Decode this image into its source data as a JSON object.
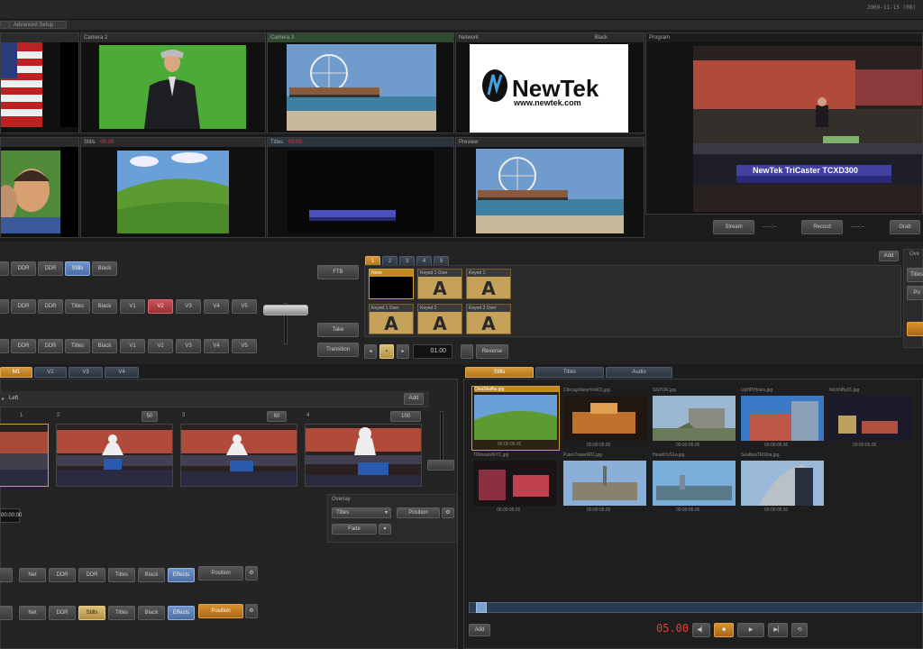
{
  "app": {
    "clock": "2009-11-15 (08)"
  },
  "top_tabs": [
    "",
    "Advanced Setup"
  ],
  "monitors": {
    "camera1": {
      "label": ""
    },
    "camera2": {
      "label": "Camera 2"
    },
    "camera3": {
      "label": "Camera 3"
    },
    "network": {
      "label": "Network",
      "extra": "Black"
    },
    "program": {
      "label": "Program"
    },
    "cam5": {
      "label": ""
    },
    "stills": {
      "label": "Stills",
      "time": "05:00"
    },
    "titles": {
      "label": "Titles",
      "time": "05:00"
    },
    "preview": {
      "label": "Preview"
    }
  },
  "newtek": {
    "brand": "NewTek",
    "url": "www.newtek.com"
  },
  "program_lower_third": "NewTek TriCaster TCXD300",
  "program_controls": {
    "stream": "Stream",
    "record": "Record",
    "grab": "Grab",
    "stream_time": "--:--:--",
    "record_time": "--:--:--"
  },
  "switcher": {
    "row1": [
      "",
      "DDR",
      "DDR",
      "Stills",
      "Black"
    ],
    "row2": [
      "",
      "DDR",
      "DDR",
      "Titles",
      "Black",
      "V1",
      "V2",
      "V3",
      "V4",
      "V5"
    ],
    "row3": [
      "",
      "DDR",
      "DDR",
      "Titles",
      "Black",
      "V1",
      "V2",
      "V3",
      "V4",
      "V5"
    ],
    "ftb": "FTB",
    "take": "Take",
    "transition": "Transition"
  },
  "trans": {
    "tabs": [
      "1",
      "2",
      "3",
      "4",
      "5"
    ],
    "add": "Add",
    "rate": "01.00",
    "reverse": "Reverse",
    "presets": [
      {
        "name": "None"
      },
      {
        "name": "Keyed 1 Over"
      },
      {
        "name": "Keyed 1"
      },
      {
        "name": "Keyed 1 Over"
      },
      {
        "name": "Keyed 2"
      },
      {
        "name": "Keyed 2 Over"
      }
    ]
  },
  "right_edge": {
    "label": "Ove",
    "b1": "Titles",
    "b2": "Po"
  },
  "vset_tabs": [
    "M1",
    "V2",
    "V3",
    "V4"
  ],
  "vset": {
    "title": "Left",
    "add": "Add",
    "positions": [
      "1",
      "2",
      "3",
      "4"
    ],
    "pos_values": [
      "",
      "50",
      "60",
      "100"
    ],
    "time": "00:00:00"
  },
  "overlay": {
    "label": "Overlay",
    "source": "Titles",
    "position": "Position",
    "fade": "Fade"
  },
  "bottom_rows": {
    "row1": [
      "",
      "Net",
      "DDR",
      "DDR",
      "Titles",
      "Black",
      "Effects"
    ],
    "row2": [
      "",
      "Net",
      "DDR",
      "Stills",
      "Titles",
      "Black",
      "Effects"
    ],
    "position": "Position",
    "orange": "Position"
  },
  "media_tabs": [
    "Stills",
    "Titles",
    "Audio"
  ],
  "media_items": [
    {
      "name": "CleaSkaflip.jpg",
      "time": "00:00:05.00"
    },
    {
      "name": "ChicagoNewYork01.jpg",
      "time": "00:00:05.00"
    },
    {
      "name": "SNYOR.jpg",
      "time": "00:00:05.00"
    },
    {
      "name": "UpHPlHoles.jpg",
      "time": "00:00:05.00"
    },
    {
      "name": "NIchNBy01.jpg",
      "time": "00:00:05.00"
    },
    {
      "name": "TIMonatsNYC.jpg",
      "time": "00:00:05.00"
    },
    {
      "name": "PulesTowerR01.jpg",
      "time": "00:00:05.00"
    },
    {
      "name": "HeadtToS1a.jpg",
      "time": "00:00:05.00"
    },
    {
      "name": "SeaBeaTRSbia.jpg",
      "time": "00:00:05.00"
    }
  ],
  "transport": {
    "add": "Add",
    "time": "05.00"
  }
}
